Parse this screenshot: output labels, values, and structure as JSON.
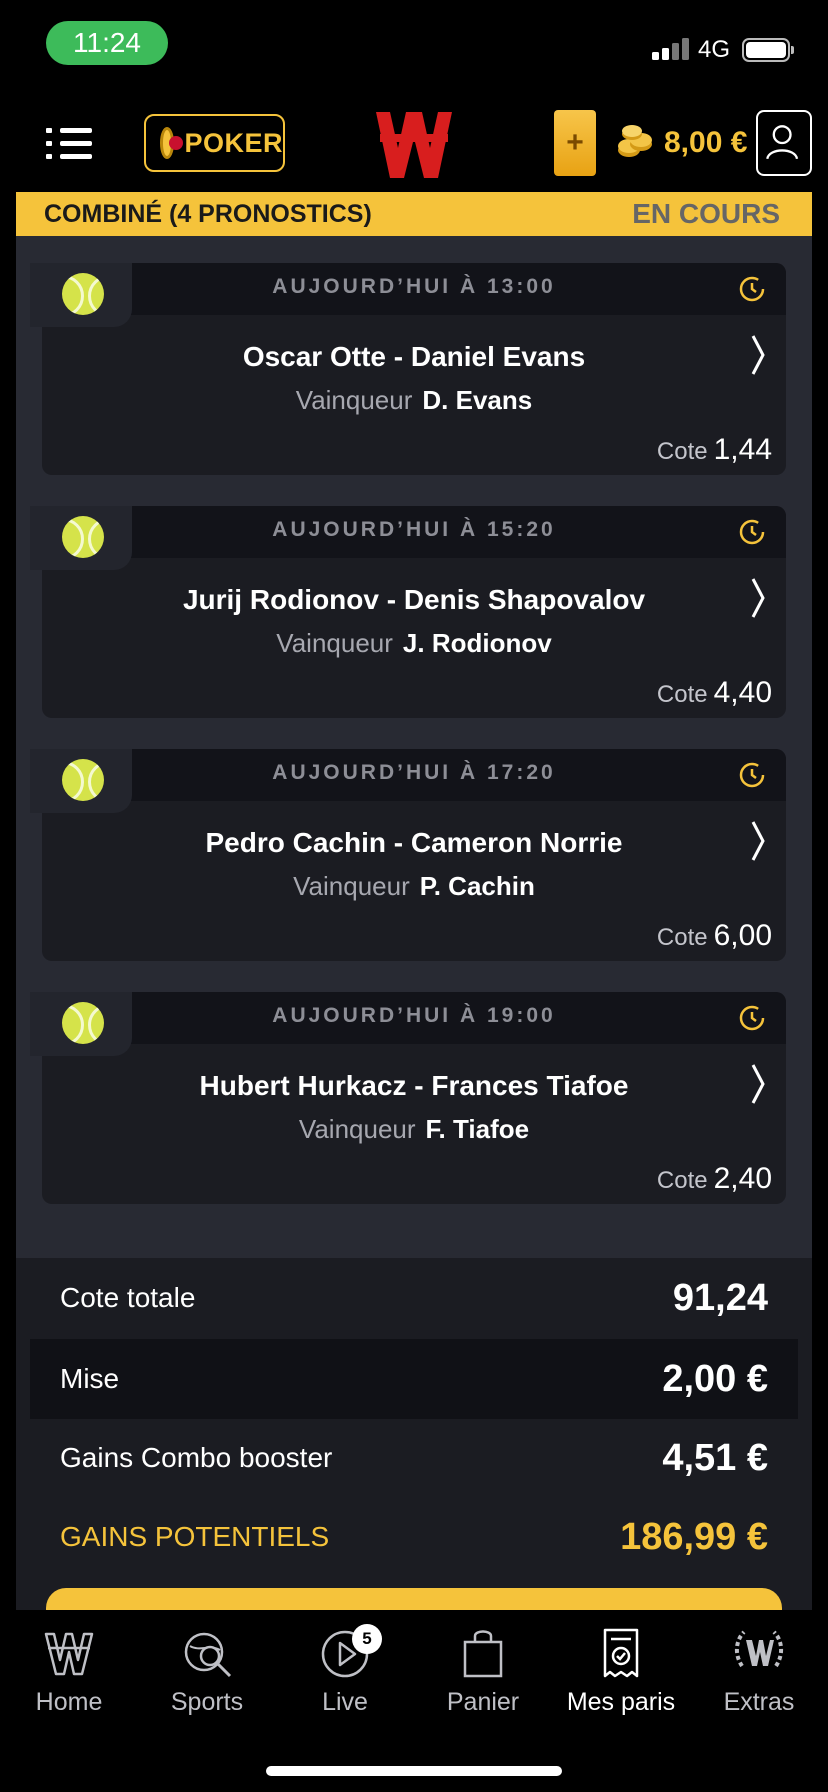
{
  "status_bar": {
    "time": "11:24",
    "network": "4G"
  },
  "header": {
    "poker_label": "POKER",
    "add_label": "+",
    "balance": "8,00 €"
  },
  "banner": {
    "title": "COMBINÉ  (4 PRONOSTICS)",
    "status": "EN COURS"
  },
  "bets": [
    {
      "time": "AUJOURD’HUI À 13:00",
      "match": "Oscar Otte - Daniel Evans",
      "pick_label": "Vainqueur",
      "pick": "D. Evans",
      "odds_label": "Cote",
      "odds": "1,44"
    },
    {
      "time": "AUJOURD’HUI À 15:20",
      "match": "Jurij Rodionov - Denis Shapovalov",
      "pick_label": "Vainqueur",
      "pick": "J. Rodionov",
      "odds_label": "Cote",
      "odds": "4,40"
    },
    {
      "time": "AUJOURD’HUI À 17:20",
      "match": "Pedro Cachin - Cameron Norrie",
      "pick_label": "Vainqueur",
      "pick": "P. Cachin",
      "odds_label": "Cote",
      "odds": "6,00"
    },
    {
      "time": "AUJOURD’HUI À 19:00",
      "match": "Hubert Hurkacz - Frances Tiafoe",
      "pick_label": "Vainqueur",
      "pick": "F. Tiafoe",
      "odds_label": "Cote",
      "odds": "2,40"
    }
  ],
  "summary": {
    "total_odds_label": "Cote totale",
    "total_odds": "91,24",
    "stake_label": "Mise",
    "stake": "2,00 €",
    "booster_label": "Gains Combo booster",
    "booster": "4,51 €",
    "potential_label": "GAINS POTENTIELS",
    "potential": "186,99 €"
  },
  "nav": {
    "home": "Home",
    "sports": "Sports",
    "live": "Live",
    "live_badge": "5",
    "basket": "Panier",
    "my_bets": "Mes paris",
    "extras": "Extras"
  },
  "colors": {
    "accent": "#f5c33b",
    "brand_red": "#c8102e",
    "status_green": "#3dbb5a"
  },
  "icons": [
    "menu-icon",
    "poker-coin-icon",
    "winamax-logo",
    "coins-icon",
    "user-icon",
    "tennis-ball-icon",
    "clock-icon",
    "chevron-right-icon",
    "home-icon",
    "sports-icon",
    "live-play-icon",
    "basket-icon",
    "my-bets-icon",
    "extras-icon"
  ]
}
